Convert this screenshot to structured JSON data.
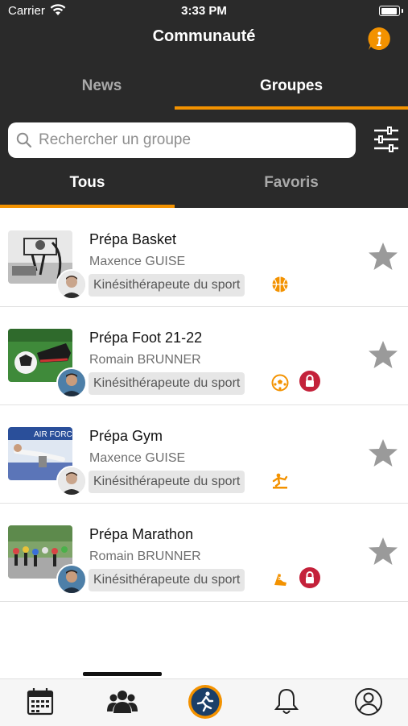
{
  "status": {
    "carrier": "Carrier",
    "time": "3:33 PM"
  },
  "header": {
    "title": "Communauté"
  },
  "tabs": {
    "news": "News",
    "groupes": "Groupes"
  },
  "search": {
    "placeholder": "Rechercher un groupe"
  },
  "subtabs": {
    "tous": "Tous",
    "favoris": "Favoris"
  },
  "colors": {
    "accent": "#f39200",
    "header_bg": "#2a2a2a",
    "lock": "#c4213a",
    "star": "#9a9a9a"
  },
  "groups": [
    {
      "name": "Prépa Basket",
      "coach": "Maxence GUISE",
      "role": "Kinésithérapeute du sport",
      "sport_icon": "basketball-icon",
      "locked": false
    },
    {
      "name": "Prépa Foot 21-22",
      "coach": "Romain BRUNNER",
      "role": "Kinésithérapeute du sport",
      "sport_icon": "soccer-ball-icon",
      "locked": true
    },
    {
      "name": "Prépa Gym",
      "coach": "Maxence GUISE",
      "role": "Kinésithérapeute du sport",
      "sport_icon": "gymnastics-icon",
      "locked": false
    },
    {
      "name": "Prépa Marathon",
      "coach": "Romain BRUNNER",
      "role": "Kinésithérapeute du sport",
      "sport_icon": "running-shoe-icon",
      "locked": true
    }
  ],
  "tabbar": [
    "calendar-icon",
    "community-icon",
    "runner-logo-icon",
    "bell-icon",
    "profile-icon"
  ]
}
